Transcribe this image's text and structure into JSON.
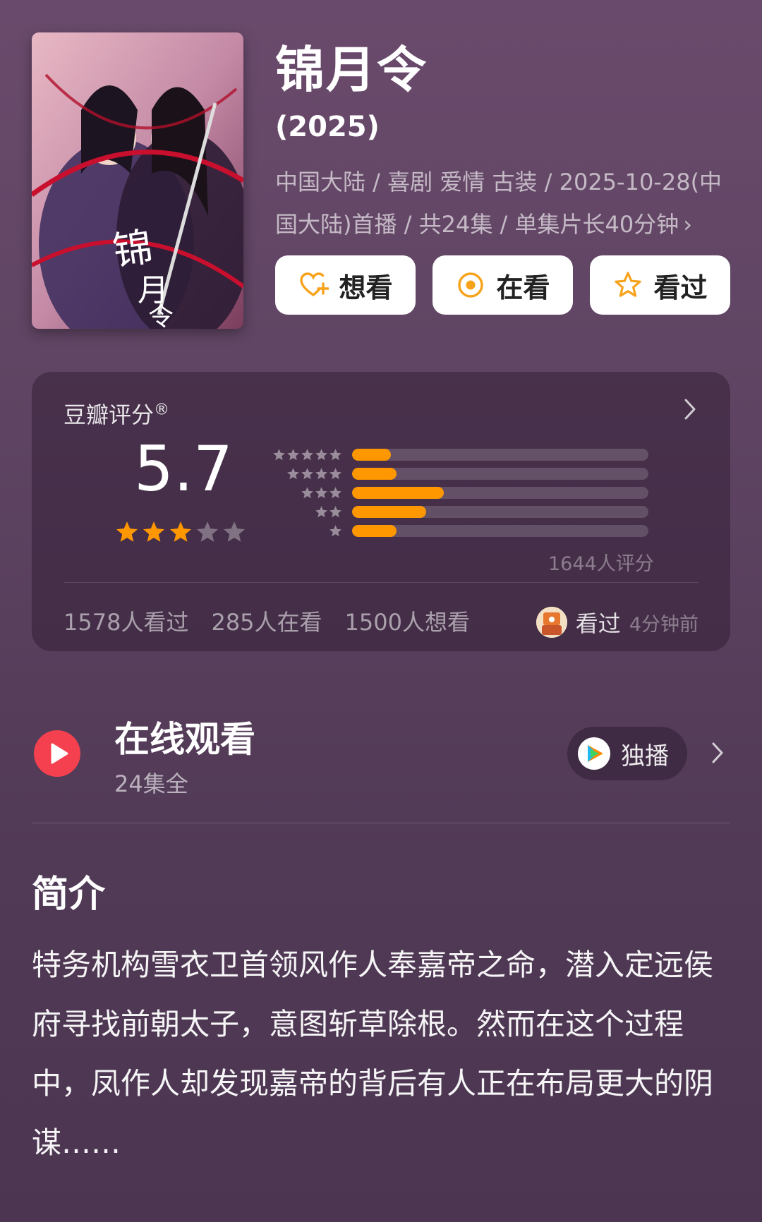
{
  "movie": {
    "title": "锦月令",
    "year": "(2025)",
    "meta_line": "中国大陆 / 喜剧 爱情 古装 / 2025-10-28(中国大陆)首播 / 共24集 / 单集片长40分钟",
    "meta_chevron": "›"
  },
  "actions": [
    {
      "label": "想看",
      "icon": "heart-plus-icon"
    },
    {
      "label": "在看",
      "icon": "target-circle-icon"
    },
    {
      "label": "看过",
      "icon": "star-outline-icon"
    }
  ],
  "rating": {
    "label": "豆瓣评分",
    "registered_mark": "®",
    "score": "5.7",
    "score_stars": 3,
    "max_stars": 5,
    "distribution": [
      {
        "stars": 5,
        "percent": 13
      },
      {
        "stars": 4,
        "percent": 15
      },
      {
        "stars": 3,
        "percent": 31
      },
      {
        "stars": 2,
        "percent": 25
      },
      {
        "stars": 1,
        "percent": 15
      }
    ],
    "count_label": "1644人评分",
    "accent_color": "#ff9800"
  },
  "stats": {
    "watched": "1578人看过",
    "watching": "285人在看",
    "want": "1500人想看"
  },
  "friend_activity": {
    "action": "看过",
    "time": "4分钟前"
  },
  "online": {
    "title": "在线观看",
    "subtitle": "24集全",
    "platform_label": "独播",
    "play_color": "#f5404f"
  },
  "synopsis": {
    "heading": "简介",
    "text": "特务机构雪衣卫首领风作人奉嘉帝之命，潜入定远侯府寻找前朝太子，意图斩草除根。然而在这个过程中，凤作人却发现嘉帝的背后有人正在布局更大的阴谋……"
  }
}
